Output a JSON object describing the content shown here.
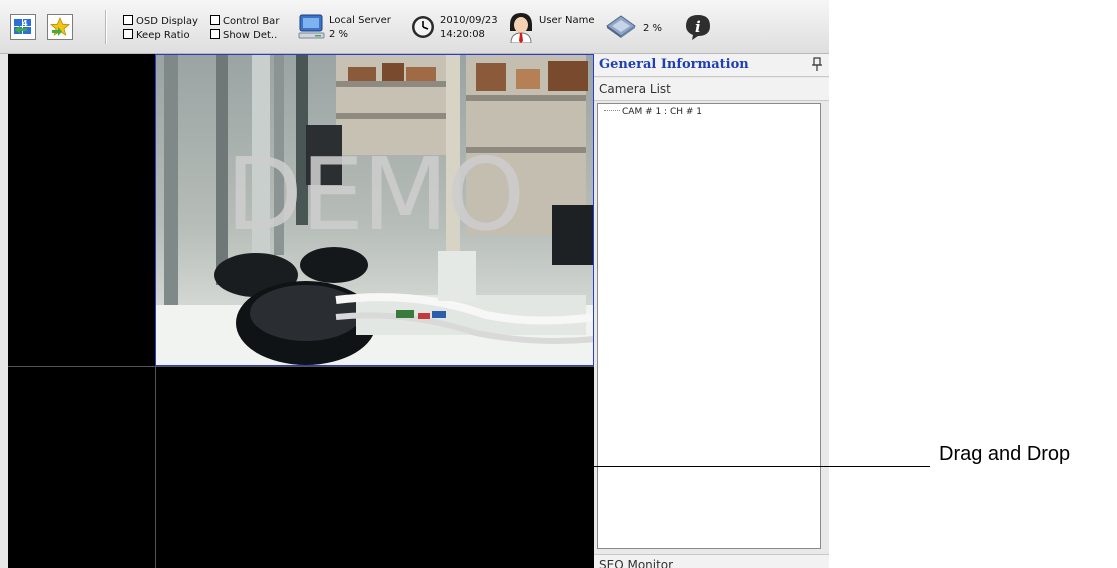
{
  "toolbar": {
    "layout_button_icon": "layout-grid-icon",
    "favorite_button_icon": "favorite-star-icon",
    "checkboxes": {
      "osd_display": {
        "label": "OSD Display",
        "checked": false
      },
      "keep_ratio": {
        "label": "Keep Ratio",
        "checked": false
      },
      "control_bar": {
        "label": "Control Bar",
        "checked": false
      },
      "show_detail": {
        "label": "Show Det..",
        "checked": false
      }
    },
    "server": {
      "name": "Local Server",
      "usage": "2 %",
      "icon": "monitor-icon"
    },
    "clock": {
      "date": "2010/09/23",
      "time": "14:20:08",
      "icon": "clock-icon"
    },
    "user": {
      "name": "User Name",
      "icon": "user-avatar-icon"
    },
    "cpu": {
      "usage": "2 %",
      "icon": "cpu-chip-icon"
    },
    "info_icon": "info-icon"
  },
  "video": {
    "overlay_text": "DEMO",
    "selected_border_color": "#2b3cc9"
  },
  "panel": {
    "general_information": "General Information",
    "camera_list_title": "Camera List",
    "cameras": [
      "CAM # 1 : CH # 1"
    ],
    "seq_monitor": "SEQ Monitor",
    "title_color": "#1e3fb5"
  },
  "annotation": {
    "drag_and_drop": "Drag and Drop"
  }
}
